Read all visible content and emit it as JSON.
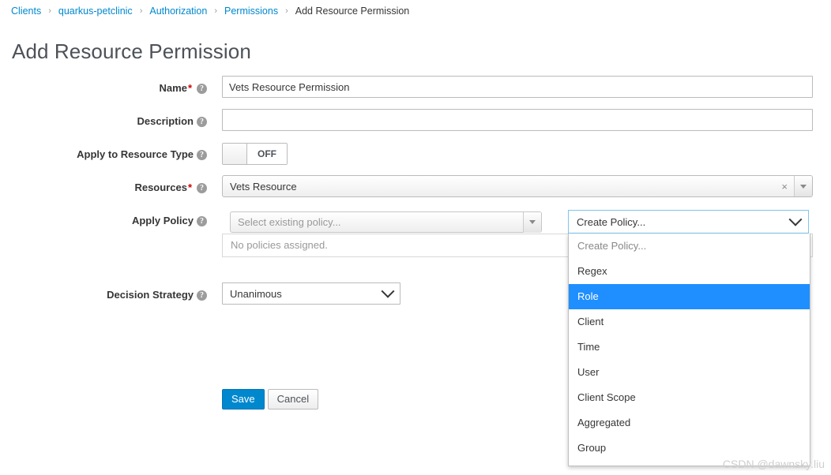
{
  "breadcrumb": {
    "items": [
      {
        "label": "Clients",
        "link": true
      },
      {
        "label": "quarkus-petclinic",
        "link": true
      },
      {
        "label": "Authorization",
        "link": true
      },
      {
        "label": "Permissions",
        "link": true
      },
      {
        "label": "Add Resource Permission",
        "link": false
      }
    ],
    "separator": "›"
  },
  "page": {
    "title": "Add Resource Permission"
  },
  "form": {
    "name": {
      "label": "Name",
      "required_marker": "*",
      "help": "?",
      "value": "Vets Resource Permission",
      "placeholder": ""
    },
    "description": {
      "label": "Description",
      "help": "?",
      "value": "",
      "placeholder": ""
    },
    "apply_to_resource_type": {
      "label": "Apply to Resource Type",
      "help": "?",
      "state": "OFF"
    },
    "resources": {
      "label": "Resources",
      "required_marker": "*",
      "help": "?",
      "value": "Vets Resource",
      "clear_icon": "×"
    },
    "apply_policy": {
      "label": "Apply Policy",
      "help": "?",
      "existing_policy_placeholder": "Select existing policy...",
      "empty_message": "No policies assigned.",
      "create_policy_value": "Create Policy...",
      "options": [
        {
          "label": "Create Policy...",
          "placeholder": true,
          "selected": false
        },
        {
          "label": "Regex",
          "placeholder": false,
          "selected": false
        },
        {
          "label": "Role",
          "placeholder": false,
          "selected": true
        },
        {
          "label": "Client",
          "placeholder": false,
          "selected": false
        },
        {
          "label": "Time",
          "placeholder": false,
          "selected": false
        },
        {
          "label": "User",
          "placeholder": false,
          "selected": false
        },
        {
          "label": "Client Scope",
          "placeholder": false,
          "selected": false
        },
        {
          "label": "Aggregated",
          "placeholder": false,
          "selected": false
        },
        {
          "label": "Group",
          "placeholder": false,
          "selected": false
        }
      ]
    },
    "decision_strategy": {
      "label": "Decision Strategy",
      "help": "?",
      "value": "Unanimous"
    }
  },
  "actions": {
    "save_label": "Save",
    "cancel_label": "Cancel"
  },
  "watermark": {
    "text": "CSDN @dawnsky.liu"
  },
  "colors": {
    "link": "#0088ce",
    "primary_button": "#0088ce",
    "dropdown_highlight": "#1f8fff",
    "required": "#cc0000",
    "title": "#4d5258"
  }
}
